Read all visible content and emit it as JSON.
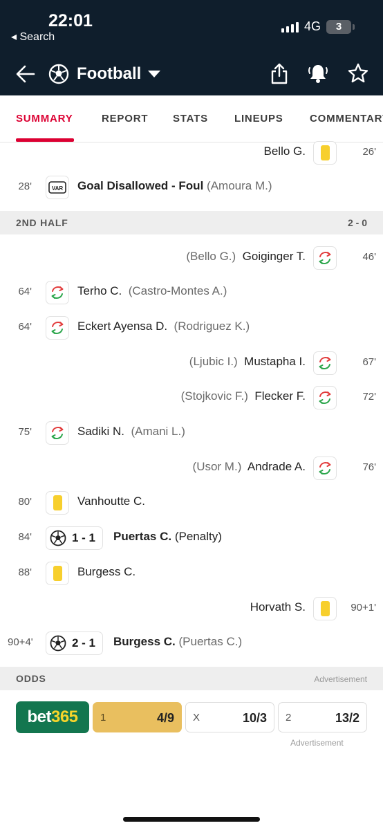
{
  "status": {
    "time": "22:01",
    "back_app": "◂ Search",
    "network": "4G",
    "battery": "3"
  },
  "nav": {
    "title": "Football"
  },
  "tabs": [
    "SUMMARY",
    "REPORT",
    "STATS",
    "LINEUPS",
    "COMMENTARY"
  ],
  "colors": {
    "accent": "#dc0032",
    "header": "#0f1e2c",
    "yellow_card": "#f7cf2d",
    "odds_selected": "#e9bf5f",
    "bet365_green": "#13764f"
  },
  "events_first_half": [
    {
      "side": "right",
      "minute": "26'",
      "type": "yellow-card",
      "player": "Bello G."
    },
    {
      "side": "left",
      "minute": "28'",
      "type": "var",
      "icon_text": "VAR",
      "title": "Goal Disallowed - Foul",
      "assist": "(Amoura M.)"
    }
  ],
  "second_half": {
    "label": "2ND HALF",
    "score": "2 - 0"
  },
  "events_second_half": [
    {
      "side": "right",
      "minute": "46'",
      "type": "substitution",
      "player": "Goiginger T.",
      "assist": "(Bello G.)"
    },
    {
      "side": "left",
      "minute": "64'",
      "type": "substitution",
      "player": "Terho C.",
      "assist": "(Castro-Montes A.)"
    },
    {
      "side": "left",
      "minute": "64'",
      "type": "substitution",
      "player": "Eckert Ayensa D.",
      "assist": "(Rodriguez K.)"
    },
    {
      "side": "right",
      "minute": "67'",
      "type": "substitution",
      "player": "Mustapha I.",
      "assist": "(Ljubic I.)"
    },
    {
      "side": "right",
      "minute": "72'",
      "type": "substitution",
      "player": "Flecker F.",
      "assist": "(Stojkovic F.)"
    },
    {
      "side": "left",
      "minute": "75'",
      "type": "substitution",
      "player": "Sadiki N.",
      "assist": "(Amani L.)"
    },
    {
      "side": "right",
      "minute": "76'",
      "type": "substitution",
      "player": "Andrade A.",
      "assist": "(Usor M.)"
    },
    {
      "side": "left",
      "minute": "80'",
      "type": "yellow-card",
      "player": "Vanhoutte C."
    },
    {
      "side": "left",
      "minute": "84'",
      "type": "goal",
      "score": "1 - 1",
      "player": "Puertas C.",
      "assist": "(Penalty)"
    },
    {
      "side": "left",
      "minute": "88'",
      "type": "yellow-card",
      "player": "Burgess C."
    },
    {
      "side": "right",
      "minute": "90+1'",
      "type": "yellow-card",
      "player": "Horvath S."
    },
    {
      "side": "left",
      "minute": "90+4'",
      "type": "goal",
      "score": "2 - 1",
      "player": "Burgess C.",
      "assist": "(Puertas C.)"
    }
  ],
  "odds": {
    "label": "ODDS",
    "ad_label": "Advertisement",
    "bookmaker_part1": "bet",
    "bookmaker_part2": "365",
    "items": [
      {
        "key": "1",
        "value": "4/9",
        "selected": true
      },
      {
        "key": "X",
        "value": "10/3",
        "selected": false
      },
      {
        "key": "2",
        "value": "13/2",
        "selected": false
      }
    ],
    "ad_bottom": "Advertisement"
  }
}
